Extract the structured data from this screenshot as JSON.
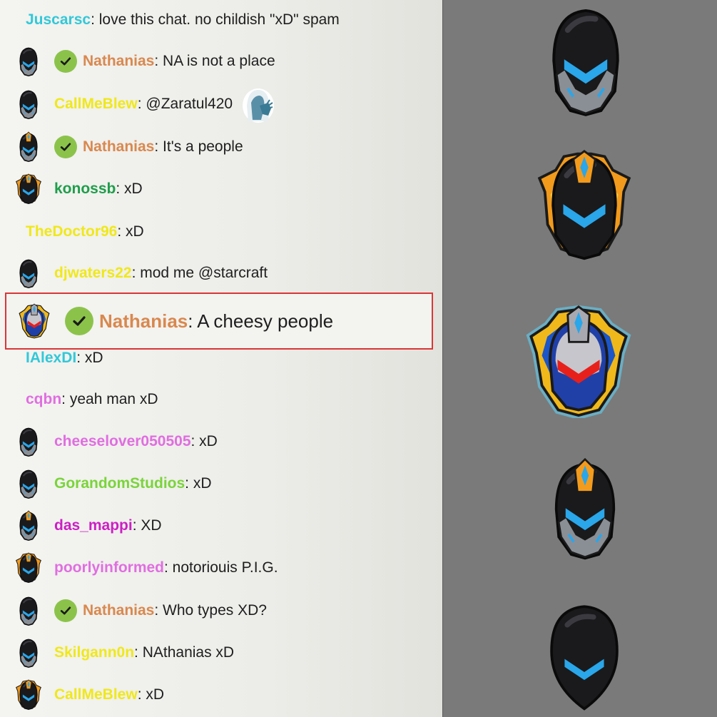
{
  "chat": {
    "messages": [
      {
        "user": "Juscarsc",
        "text": ": love this chat. no childish \"xD\" spam",
        "user_color": "#32c8d8",
        "avatar": null,
        "verified": false
      },
      {
        "user": "Nathanias",
        "text": ": NA is not a place",
        "user_color": "#d9884e",
        "avatar": "black-helmet",
        "verified": true
      },
      {
        "user": "CallMeBlew",
        "text": ": @Zaratul420",
        "user_color": "#f0e81a",
        "avatar": "black-helmet",
        "verified": false,
        "emote": "ghost-emote"
      },
      {
        "user": "Nathanias",
        "text": ": It's a people",
        "user_color": "#d9884e",
        "avatar": "black-helmet-orange-crest",
        "verified": true
      },
      {
        "user": "konossb",
        "text": ": xD",
        "user_color": "#1e9e4a",
        "avatar": "orange-helmet",
        "verified": false
      },
      {
        "user": "TheDoctor96",
        "text": ": xD",
        "user_color": "#f0e81a",
        "avatar": null,
        "verified": false
      },
      {
        "user": "djwaters22",
        "text": ": mod me @starcraft",
        "user_color": "#f0e81a",
        "avatar": "black-helmet",
        "verified": false
      },
      {
        "user": "IAlexDI",
        "text": ": xD",
        "user_color": "#32c8d8",
        "avatar": null,
        "verified": false
      },
      {
        "user": "cqbn",
        "text": ": yeah man xD",
        "user_color": "#e06ee0",
        "avatar": null,
        "verified": false
      },
      {
        "user": "cheeselover050505",
        "text": ": xD",
        "user_color": "#e06ee0",
        "avatar": "black-helmet",
        "verified": false
      },
      {
        "user": "GorandomStudios",
        "text": ": xD",
        "user_color": "#7ad43a",
        "avatar": "black-helmet",
        "verified": false
      },
      {
        "user": "das_mappi",
        "text": ": XD",
        "user_color": "#cc1fc4",
        "avatar": "black-helmet-orange-crest",
        "verified": false
      },
      {
        "user": "poorlyinformed",
        "text": ": notoriouis P.I.G.",
        "user_color": "#e06ee0",
        "avatar": "orange-helmet",
        "verified": false
      },
      {
        "user": "Nathanias",
        "text": ": Who types XD?",
        "user_color": "#d9884e",
        "avatar": "black-helmet",
        "verified": true
      },
      {
        "user": "Skilgann0n",
        "text": ": NAthanias xD",
        "user_color": "#f0e81a",
        "avatar": "black-helmet",
        "verified": false
      },
      {
        "user": "CallMeBlew",
        "text": ": xD",
        "user_color": "#f0e81a",
        "avatar": "orange-helmet",
        "verified": false
      }
    ],
    "highlight": {
      "user": "Nathanias",
      "text": ": A cheesy people",
      "user_color": "#d9884e",
      "avatar": "blue-red-helmet",
      "verified": true,
      "border_color": "#d93636"
    }
  },
  "sidebar": {
    "icons": [
      "black-helmet-icon",
      "orange-helmet-icon",
      "blue-red-helmet-icon",
      "black-helmet-orange-crest-icon",
      "black-helmet-basic-icon"
    ],
    "background": "#7a7a7a"
  }
}
